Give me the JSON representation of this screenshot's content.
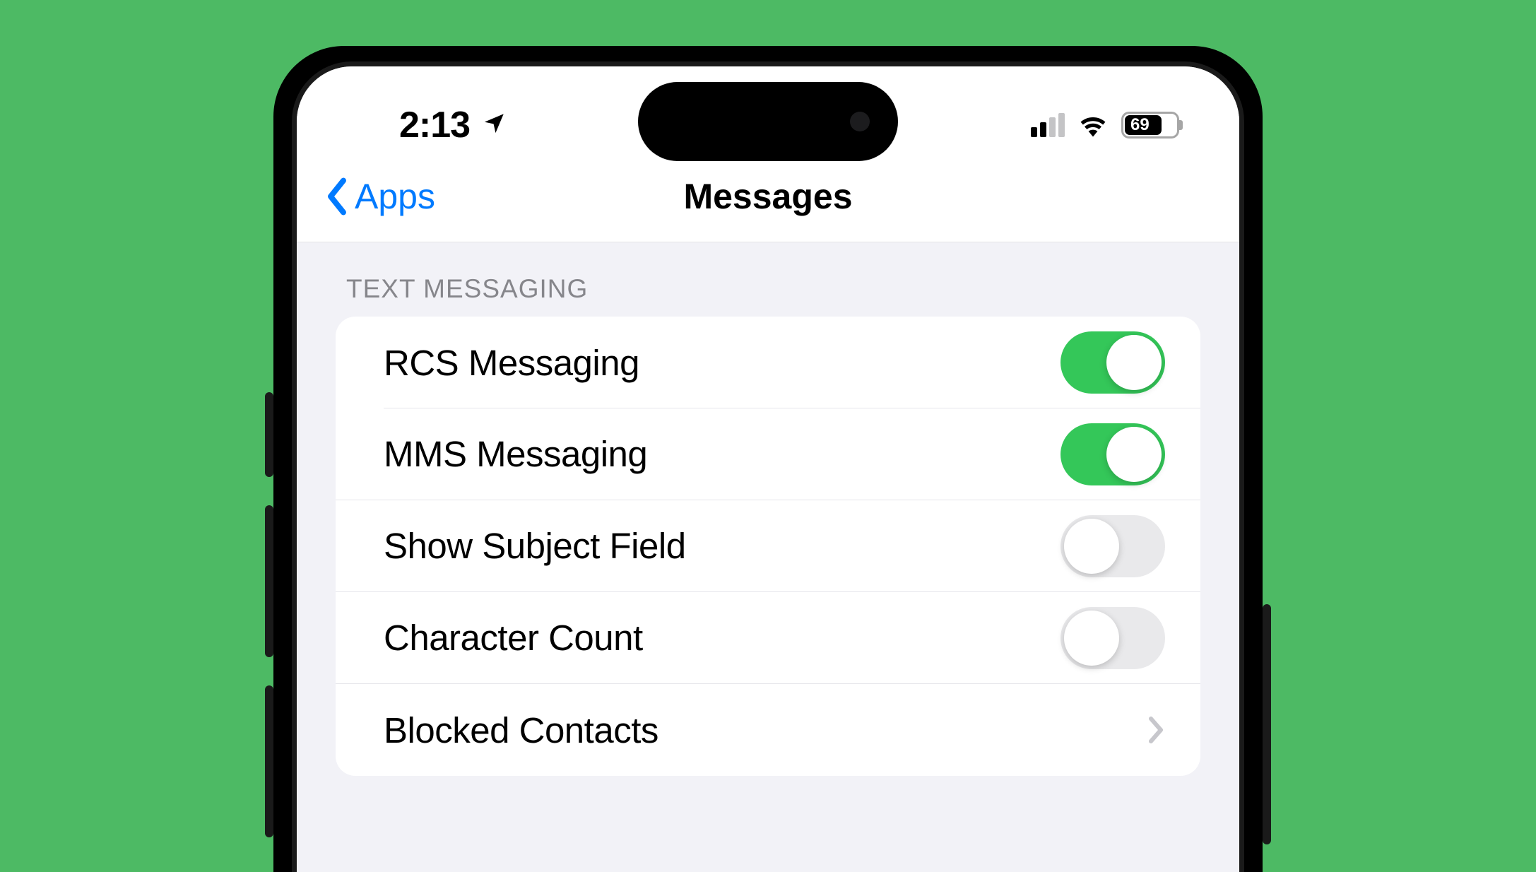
{
  "status": {
    "time": "2:13",
    "battery": "69"
  },
  "nav": {
    "back_label": "Apps",
    "title": "Messages"
  },
  "section": {
    "header": "TEXT MESSAGING"
  },
  "rows": {
    "rcs": {
      "label": "RCS Messaging",
      "on": true
    },
    "mms": {
      "label": "MMS Messaging",
      "on": true
    },
    "subject": {
      "label": "Show Subject Field",
      "on": false
    },
    "charcount": {
      "label": "Character Count",
      "on": false
    },
    "blocked": {
      "label": "Blocked Contacts"
    }
  }
}
